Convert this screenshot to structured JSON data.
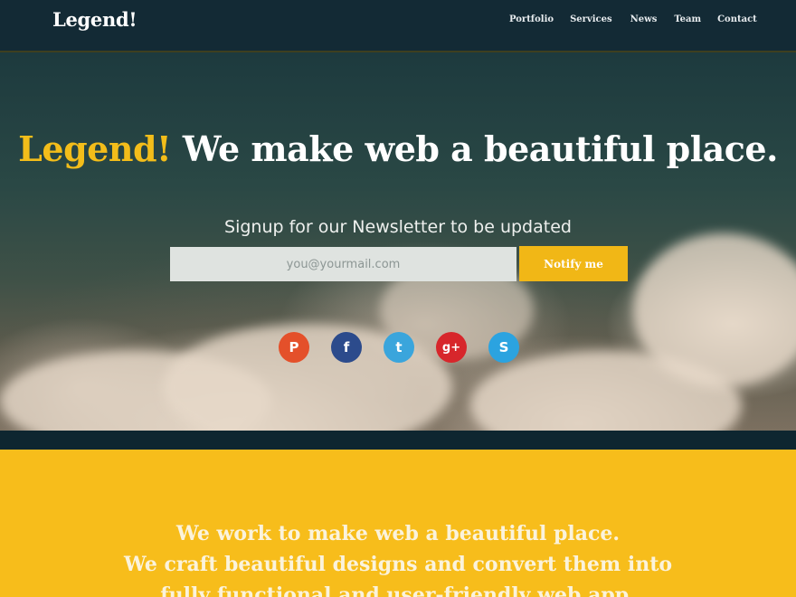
{
  "brand": "Legend!",
  "nav": {
    "items": [
      {
        "label": "Portfolio"
      },
      {
        "label": "Services"
      },
      {
        "label": "News"
      },
      {
        "label": "Team"
      },
      {
        "label": "Contact"
      }
    ]
  },
  "hero": {
    "title_accent": "Legend!",
    "title_rest": " We make web a beautiful place.",
    "signup_text": "Signup for our Newsletter to be updated",
    "email_placeholder": "you@yourmail.com",
    "notify_label": "Notify me"
  },
  "social": [
    {
      "icon": "pinterest-icon",
      "glyph": "P",
      "color": "#e4502a"
    },
    {
      "icon": "facebook-icon",
      "glyph": "f",
      "color": "#2c4b8c"
    },
    {
      "icon": "twitter-icon",
      "glyph": "t",
      "color": "#3aa5dc"
    },
    {
      "icon": "google-plus-icon",
      "glyph": "g+",
      "color": "#d7262b"
    },
    {
      "icon": "skype-icon",
      "glyph": "S",
      "color": "#2ba3e0"
    }
  ],
  "about": {
    "lines": [
      "We work to make web a beautiful place.",
      "We craft beautiful designs and convert them into",
      "fully functional and user-friendly web app."
    ]
  },
  "colors": {
    "accent": "#f3bd1a",
    "nav_bg": "#132a35",
    "about_bg": "#f7bd1b"
  }
}
